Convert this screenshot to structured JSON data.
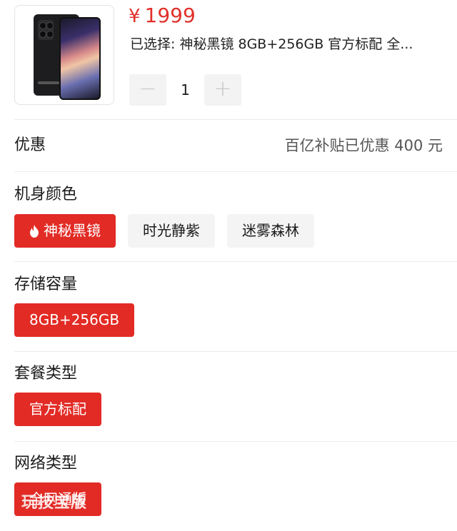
{
  "product": {
    "currency": "¥",
    "price": "1999",
    "selected_text": "已选择: 神秘黑镜 8GB+256GB 官方标配 全...",
    "quantity": "1",
    "minus_label": "−",
    "plus_label": "+"
  },
  "promo": {
    "label": "优惠",
    "value": "百亿补贴已优惠 400 元"
  },
  "color": {
    "title": "机身颜色",
    "options": [
      "神秘黑镜",
      "时光静紫",
      "迷雾森林"
    ],
    "selected_icon": "flame-icon"
  },
  "storage": {
    "title": "存储容量",
    "options": [
      "8GB+256GB"
    ]
  },
  "package": {
    "title": "套餐类型",
    "options": [
      "官方标配"
    ]
  },
  "network": {
    "title": "网络类型",
    "options": [
      "全网通版"
    ]
  },
  "watermark": "玩技宝版",
  "colors": {
    "accent": "#e22b25",
    "price": "#e0302a",
    "chip_bg": "#f4f4f4"
  }
}
